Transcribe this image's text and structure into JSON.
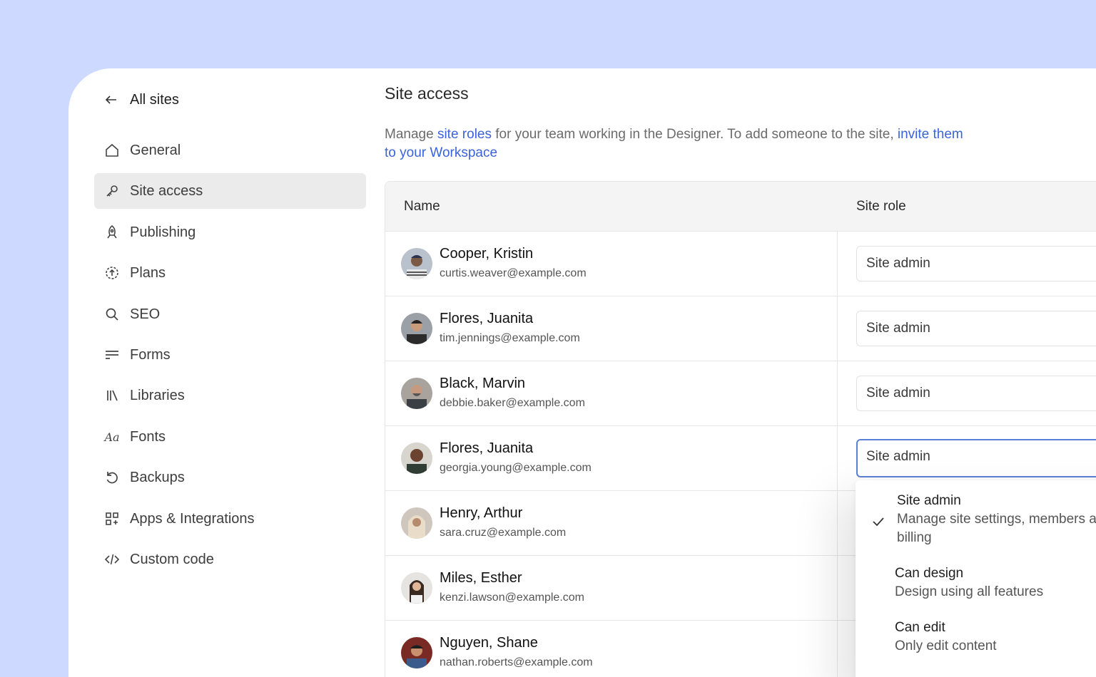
{
  "sidebar": {
    "back_label": "All sites",
    "items": [
      {
        "label": "General",
        "icon": "home-icon"
      },
      {
        "label": "Site access",
        "icon": "key-icon",
        "active": true
      },
      {
        "label": "Publishing",
        "icon": "rocket-icon"
      },
      {
        "label": "Plans",
        "icon": "plans-icon"
      },
      {
        "label": "SEO",
        "icon": "search-icon"
      },
      {
        "label": "Forms",
        "icon": "forms-icon"
      },
      {
        "label": "Libraries",
        "icon": "libraries-icon"
      },
      {
        "label": "Fonts",
        "icon": "fonts-icon"
      },
      {
        "label": "Backups",
        "icon": "backup-icon"
      },
      {
        "label": "Apps & Integrations",
        "icon": "apps-icon"
      },
      {
        "label": "Custom code",
        "icon": "code-icon"
      }
    ]
  },
  "main": {
    "title": "Site access",
    "desc_before": "Manage ",
    "desc_link1": "site roles",
    "desc_middle": " for your team working in the Designer. To add someone to the site, ",
    "desc_link2": "invite them to your Workspace",
    "table": {
      "col_name": "Name",
      "col_role": "Site role",
      "rows": [
        {
          "name": "Cooper, Kristin",
          "email": "curtis.weaver@example.com",
          "role": "Site admin"
        },
        {
          "name": "Flores, Juanita",
          "email": "tim.jennings@example.com",
          "role": "Site admin"
        },
        {
          "name": "Black, Marvin",
          "email": "debbie.baker@example.com",
          "role": "Site admin"
        },
        {
          "name": "Flores, Juanita",
          "email": "georgia.young@example.com",
          "role": "Site admin"
        },
        {
          "name": "Henry, Arthur",
          "email": "sara.cruz@example.com",
          "role": ""
        },
        {
          "name": "Miles, Esther",
          "email": "kenzi.lawson@example.com",
          "role": ""
        },
        {
          "name": "Nguyen, Shane",
          "email": "nathan.roberts@example.com",
          "role": ""
        }
      ]
    },
    "dropdown": {
      "options": [
        {
          "title": "Site admin",
          "desc": "Manage site settings, members and billing",
          "selected": true
        },
        {
          "title": "Can design",
          "desc": "Design using all features"
        },
        {
          "title": "Can edit",
          "desc": "Only edit content"
        }
      ]
    }
  },
  "colors": {
    "background": "#cdd9ff",
    "link": "#3b63d9",
    "focus": "#5b7fd6",
    "active_nav": "#ebebeb"
  }
}
